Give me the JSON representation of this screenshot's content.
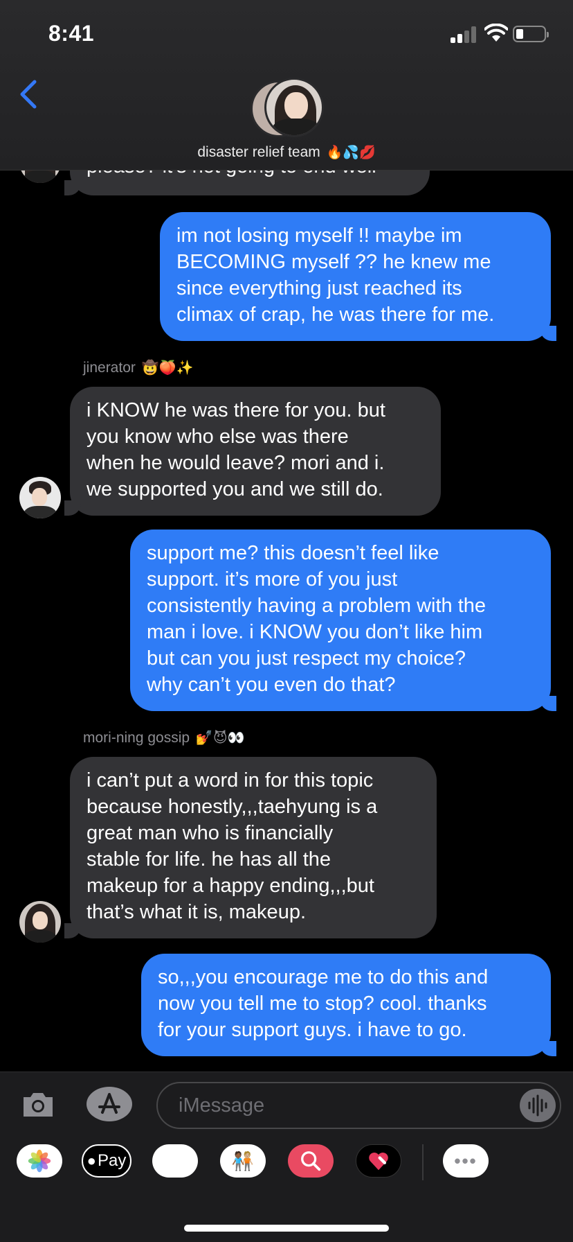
{
  "status": {
    "time": "8:41"
  },
  "header": {
    "group_name": "disaster relief team",
    "group_emoji": "🔥💦💋"
  },
  "messages": [
    {
      "dir": "in",
      "sender": "",
      "lines": [
        "please? it’s not going to end well"
      ]
    },
    {
      "dir": "out",
      "lines": [
        "im not losing myself !! maybe im",
        "BECOMING myself ?? he knew me",
        "since everything just reached its",
        "climax of crap, he was there for me."
      ]
    },
    {
      "dir": "in",
      "sender": "jinerator",
      "sender_emoji": "🤠🍑✨",
      "lines": [
        "i KNOW he was there for you. but",
        "you know who else was there",
        "when he would leave? mori and i.",
        "we supported you and we still do."
      ]
    },
    {
      "dir": "out",
      "lines": [
        "support me? this doesn’t feel like",
        "support. it’s more of you just",
        "consistently having a problem with the",
        "man i love. i KNOW you don’t like him",
        "but can you just respect my choice?",
        "why can’t you even do that?"
      ]
    },
    {
      "dir": "in",
      "sender": "mori-ning gossip",
      "sender_emoji": "💅😈👀",
      "lines": [
        "i can’t put a word in for this topic",
        "because honestly,,,taehyung is a",
        "great man who is financially",
        "stable for life. he has all the",
        "makeup for a happy ending,,,but",
        "that’s what it is, makeup."
      ]
    },
    {
      "dir": "out",
      "lines": [
        "so,,,you encourage me to do this and",
        "now you tell me to stop? cool. thanks",
        "for your support guys. i have to go."
      ]
    }
  ],
  "input": {
    "placeholder": "iMessage"
  },
  "apps": {
    "pay_label": "Pay",
    "monkey": "🐵",
    "memoji": "🧑🏾‍🤝‍🧑🏼",
    "more": "•••"
  },
  "colors": {
    "outgoing": "#2f7cf6",
    "incoming": "#333336",
    "accent": "#3478f6"
  }
}
